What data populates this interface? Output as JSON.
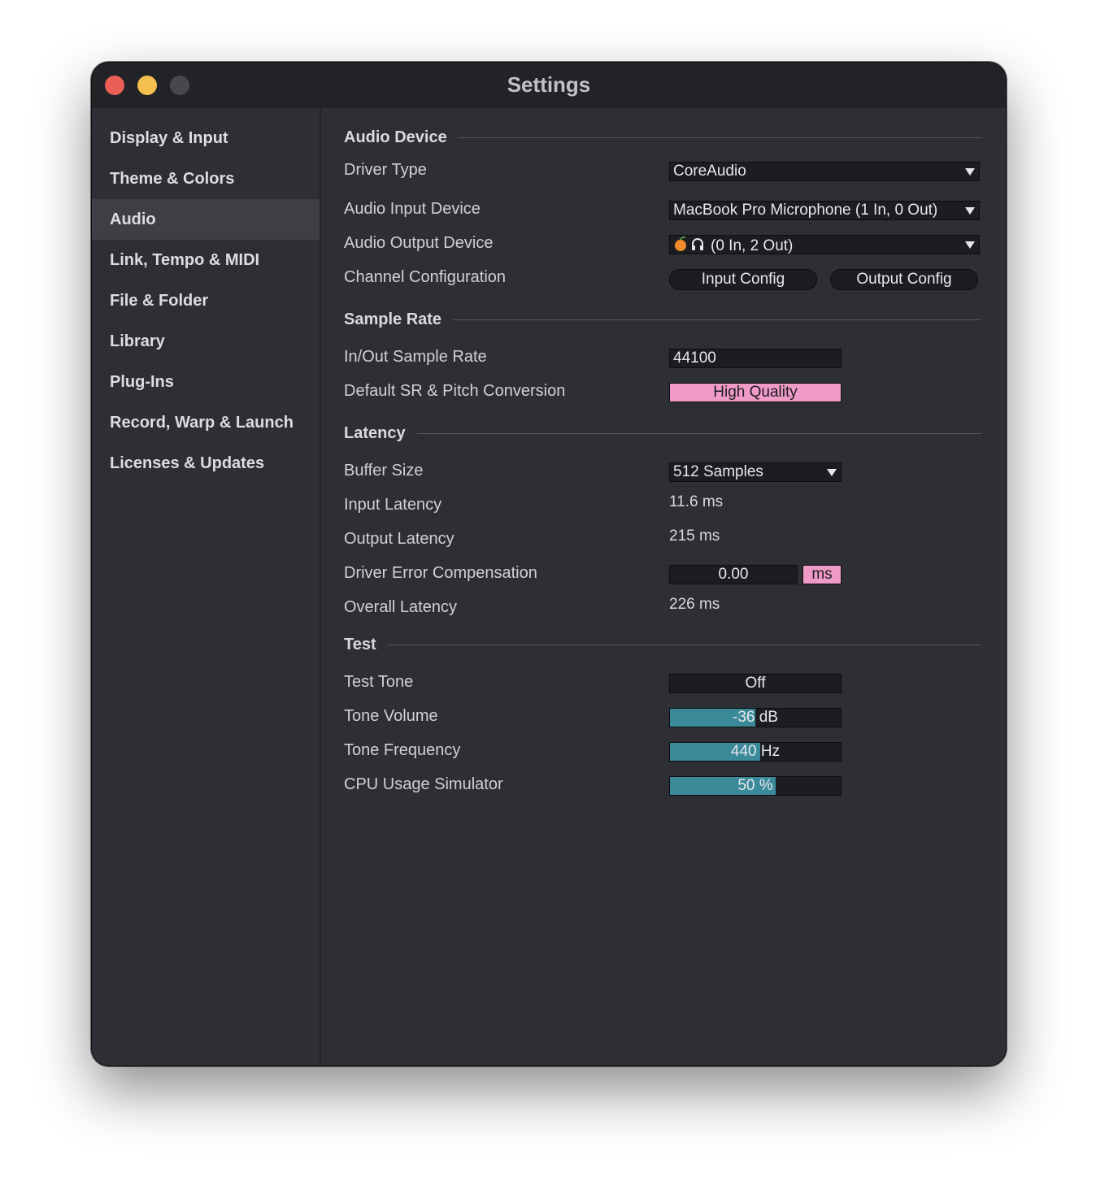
{
  "window": {
    "title": "Settings"
  },
  "sidebar": {
    "items": [
      {
        "label": "Display & Input"
      },
      {
        "label": "Theme & Colors"
      },
      {
        "label": "Audio",
        "active": true
      },
      {
        "label": "Link, Tempo & MIDI"
      },
      {
        "label": "File & Folder"
      },
      {
        "label": "Library"
      },
      {
        "label": "Plug-Ins"
      },
      {
        "label": "Record, Warp & Launch"
      },
      {
        "label": "Licenses & Updates"
      }
    ]
  },
  "audio_device": {
    "section_title": "Audio Device",
    "driver_type": {
      "label": "Driver Type",
      "value": "CoreAudio"
    },
    "input_device": {
      "label": "Audio Input Device",
      "value": "MacBook Pro Microphone (1 In, 0 Out)"
    },
    "output_device": {
      "label": "Audio Output Device",
      "value": "(0 In, 2 Out)",
      "icons": [
        "peach-icon",
        "headphones-icon"
      ]
    },
    "channel_config": {
      "label": "Channel Configuration",
      "input_button": "Input Config",
      "output_button": "Output Config"
    }
  },
  "sample_rate": {
    "section_title": "Sample Rate",
    "rate": {
      "label": "In/Out Sample Rate",
      "value": "44100"
    },
    "conversion": {
      "label": "Default SR & Pitch Conversion",
      "value": "High Quality"
    }
  },
  "latency": {
    "section_title": "Latency",
    "buffer_size": {
      "label": "Buffer Size",
      "value": "512 Samples"
    },
    "input_latency": {
      "label": "Input Latency",
      "value": "11.6 ms"
    },
    "output_latency": {
      "label": "Output Latency",
      "value": "215 ms"
    },
    "driver_error": {
      "label": "Driver Error Compensation",
      "value": "0.00",
      "unit": "ms"
    },
    "overall_latency": {
      "label": "Overall Latency",
      "value": "226 ms"
    }
  },
  "test": {
    "section_title": "Test",
    "test_tone": {
      "label": "Test Tone",
      "value": "Off"
    },
    "tone_volume": {
      "label": "Tone Volume",
      "value": "-36 dB",
      "fill_fraction": 0.5
    },
    "tone_frequency": {
      "label": "Tone Frequency",
      "value": "440 Hz",
      "fill_fraction": 0.53
    },
    "cpu_usage": {
      "label": "CPU Usage Simulator",
      "value": "50 %",
      "fill_fraction": 0.62
    }
  },
  "colors": {
    "accent_pink": "#f09bc7",
    "slider_fill": "#3b8a9a",
    "window_bg": "#2e2f34",
    "close": "#ec5f57",
    "minimize": "#f4bf4f"
  }
}
